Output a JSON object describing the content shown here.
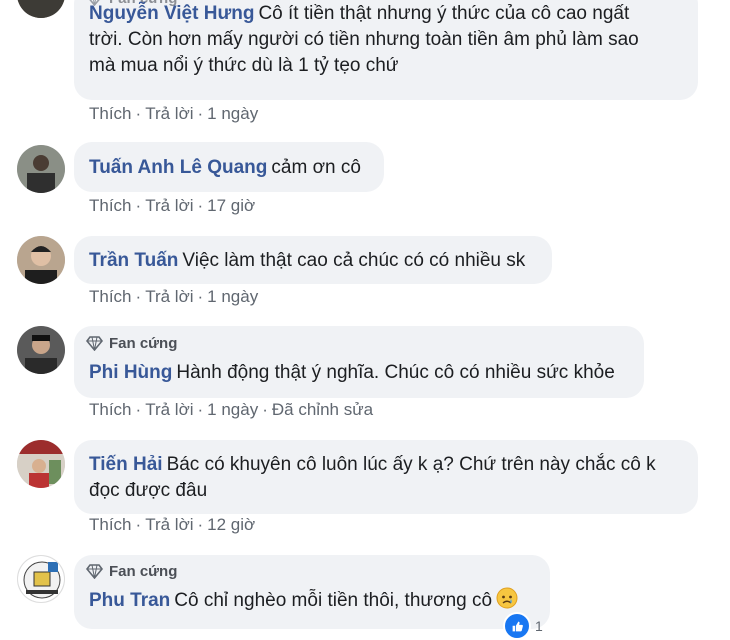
{
  "badge_label": "Fan cứng",
  "actions": {
    "like": "Thích",
    "reply": "Trả lời",
    "sep": "·"
  },
  "comments": [
    {
      "author": "Nguyễn Việt Hưng",
      "lines": [
        "Cô ít tiền thật nhưng ý thức của cô cao ngất",
        "trời. Còn hơn mấy người có tiền nhưng toàn tiền âm phủ làm sao",
        "mà mua nổi ý thức dù là 1 tỷ tẹo chứ"
      ],
      "time": "1 ngày",
      "badge": true
    },
    {
      "author": "Tuấn Anh Lê Quang",
      "lines": [
        "cảm ơn cô"
      ],
      "time": "17 giờ",
      "badge": false
    },
    {
      "author": "Trần Tuấn",
      "lines": [
        "Việc làm thật cao cả chúc có có nhiều sk"
      ],
      "time": "1 ngày",
      "badge": false
    },
    {
      "author": "Phi Hùng",
      "lines": [
        "Hành động thật ý nghĩa. Chúc cô có nhiều sức khỏe"
      ],
      "time": "1 ngày",
      "edited": "Đã chỉnh sửa",
      "badge": true
    },
    {
      "author": "Tiến Hải",
      "lines": [
        "Bác có khuyên cô luôn lúc ấy k ạ? Chứ trên này chắc cô k",
        "đọc được đâu"
      ],
      "time": "12 giờ",
      "badge": false
    },
    {
      "author": "Phu Tran",
      "lines": [
        "Cô chỉ nghèo mỗi tiền thôi, thương cô"
      ],
      "badge": true,
      "emoji": "sad-face-emoji"
    }
  ],
  "reactions": {
    "count": "1",
    "icon": "like-reaction-icon",
    "color": "#1877f2"
  },
  "colors": {
    "author": "#385898",
    "bubble": "#f0f2f5",
    "meta": "#606770"
  }
}
